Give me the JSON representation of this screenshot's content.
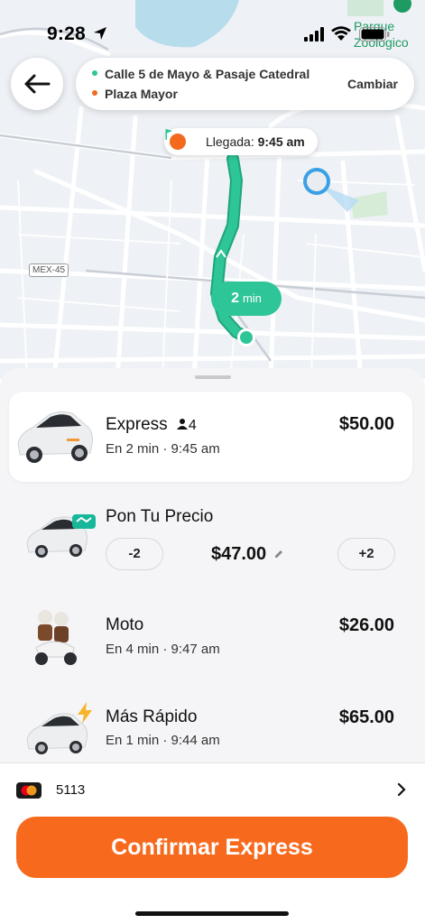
{
  "status": {
    "time": "9:28"
  },
  "map": {
    "poi_label_line1": "Parque",
    "poi_label_line2": "Zoológico",
    "road_label": "MEX-45",
    "arrival_label": "Llegada:",
    "arrival_time": "9:45 am",
    "eta_value": "2",
    "eta_unit": "min"
  },
  "route": {
    "from": "Calle 5 de Mayo & Pasaje Catedral",
    "to": "Plaza Mayor",
    "change_label": "Cambiar",
    "from_color": "#2ec598",
    "to_color": "#f36a1e"
  },
  "rides": [
    {
      "name": "Express",
      "seats": "4",
      "sub": "En 2 min · 9:45 am",
      "price": "$50.00",
      "selected": true
    },
    {
      "name": "Pon Tu Precio",
      "price": "$47.00",
      "decrease_label": "-2",
      "increase_label": "+2"
    },
    {
      "name": "Moto",
      "sub": "En 4 min · 9:47 am",
      "price": "$26.00"
    },
    {
      "name": "Más Rápido",
      "sub": "En 1 min · 9:44 am",
      "price": "$65.00"
    }
  ],
  "payment": {
    "card_last4": "5113",
    "icon": "mastercard-icon"
  },
  "confirm_label": "Confirmar Express",
  "colors": {
    "accent": "#f76a1e",
    "route": "#2ec598"
  }
}
